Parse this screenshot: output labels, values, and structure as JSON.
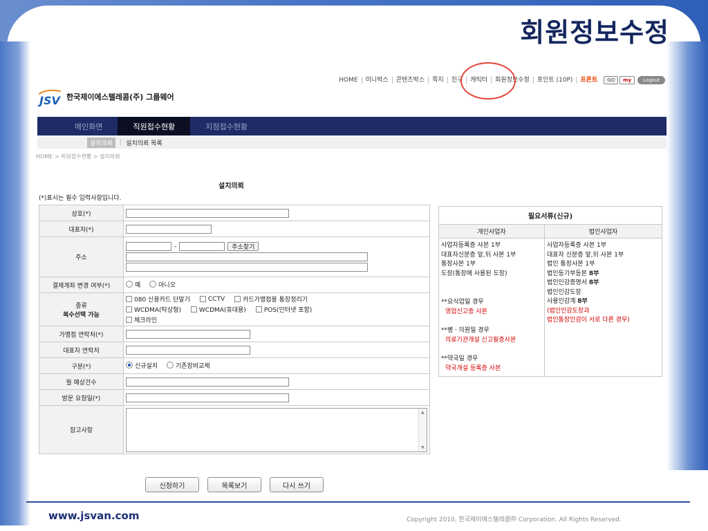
{
  "slide": {
    "title": "회원정보수정",
    "footer_url": "www.jsvan.com",
    "footer_copyright": "Copyright 2010, 한국제이에스텔레콤㈜ Corporation. All Rights Reserved."
  },
  "topnav": {
    "items": [
      "HOME",
      "미니박스",
      "콘텐츠박스",
      "쪽지",
      "친구",
      "캐릭터",
      "회원정보수정",
      "포인트 (10P)"
    ],
    "highlight": "프론트",
    "go_label": "GO",
    "my_label": "my",
    "logout_label": "Logout"
  },
  "logo": {
    "text": "한국제이에스텔레콤(주) 그룹웨어"
  },
  "mainnav": {
    "tabs": [
      "메인화면",
      "직원접수현황",
      "지점접수현황"
    ]
  },
  "subnav": {
    "active": "설치의뢰",
    "other": "설치의뢰 목록"
  },
  "breadcrumb": "HOME > 직원접수현황 > 설치의뢰",
  "form": {
    "title": "설치의뢰",
    "note": "(*)표시는 필수 입력사항입니다.",
    "labels": {
      "company": "상호(*)",
      "ceo": "대표자(*)",
      "address": "주소",
      "account_change": "결제계좌 변경 여부(*)",
      "type_line1": "종류",
      "type_line2": "복수선택 가능",
      "store_contact": "가맹점 연락처(*)",
      "ceo_contact": "대표자 연락처",
      "category": "구분(*)",
      "monthly": "월 예상건수",
      "visit_date": "방문 요청일(*)",
      "remarks": "참고사항"
    },
    "address_dash": "-",
    "address_button": "주소찾기",
    "account_options": [
      "예",
      "아니오"
    ],
    "type_options_row1": [
      "080 신용카드 단말기",
      "CCTV",
      "카드가맹점용 통장정리기"
    ],
    "type_options_row2": [
      "WCDMA(탁상형)",
      "WCDMA(휴대용)",
      "POS(인터넷 포함)"
    ],
    "type_options_row3": [
      "체크라인"
    ],
    "category_options": [
      "신규설치",
      "기존장비교체"
    ],
    "buttons": [
      "신청하기",
      "목록보기",
      "다시 쓰기"
    ]
  },
  "docs": {
    "title": "필요서류(신규)",
    "col_personal": "개인사업자",
    "col_corporate": "법인사업자",
    "personal": {
      "line1": "사업자등록증 사본 1부",
      "line2": "대표자신분증 앞,뒤 사본 1부",
      "line3": "통장사본 1부",
      "line4": "도장(통장에 사용된 도장)",
      "food_title": "**요식업일 경우",
      "food_doc": "영업신고증 사본",
      "clinic_title": "**병ㆍ의원일 경우",
      "clinic_doc": "의료기관개설 신고필증사본",
      "pharmacy_title": "**약국일 경우",
      "pharmacy_doc": "약국개설 등록증 사본"
    },
    "corporate": {
      "line1": "사업자등록증 사본 1부",
      "line2": "대표자 신분증 앞,뒤 사본 1부",
      "line3": "법인 통장사본 1부",
      "line4_text": "법인등기부등본",
      "line4_count": "8부",
      "line5_text": "법인인감증명서",
      "line5_count": "8부",
      "line6": "법인인감도장",
      "line7_text": "사용인감계",
      "line7_count": "8부",
      "note1": "(법인인감도장과",
      "note2": "법인통장인감이 서로 다른 경우)"
    }
  },
  "colors": {
    "nav_bg": "#1f2b66",
    "nav_active": "#0c0f24",
    "highlight_circle": "#e0463a",
    "title": "#14265e",
    "red_text": "#d40000"
  }
}
